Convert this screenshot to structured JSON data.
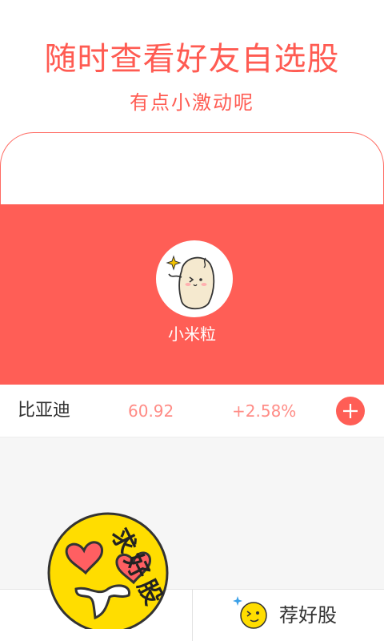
{
  "promo": {
    "headline": "随时查看好友自选股",
    "subline": "有点小激动呢"
  },
  "profile": {
    "username": "小米粒"
  },
  "stock": {
    "name": "比亚迪",
    "price": "60.92",
    "change": "+2.58%"
  },
  "stamp": {
    "text": "求好股"
  },
  "bottom_bar": {
    "right_tab_label": "荐好股"
  },
  "colors": {
    "brand": "#ff5e56",
    "price_text": "#ff8c86",
    "emoji_yellow": "#ffdd00"
  },
  "icons": {
    "add": "plus-circle-icon",
    "emoji": "heart-eyes-emoji-icon",
    "tab_icon": "wink-emoji-icon",
    "sparkle": "sparkle-icon"
  }
}
